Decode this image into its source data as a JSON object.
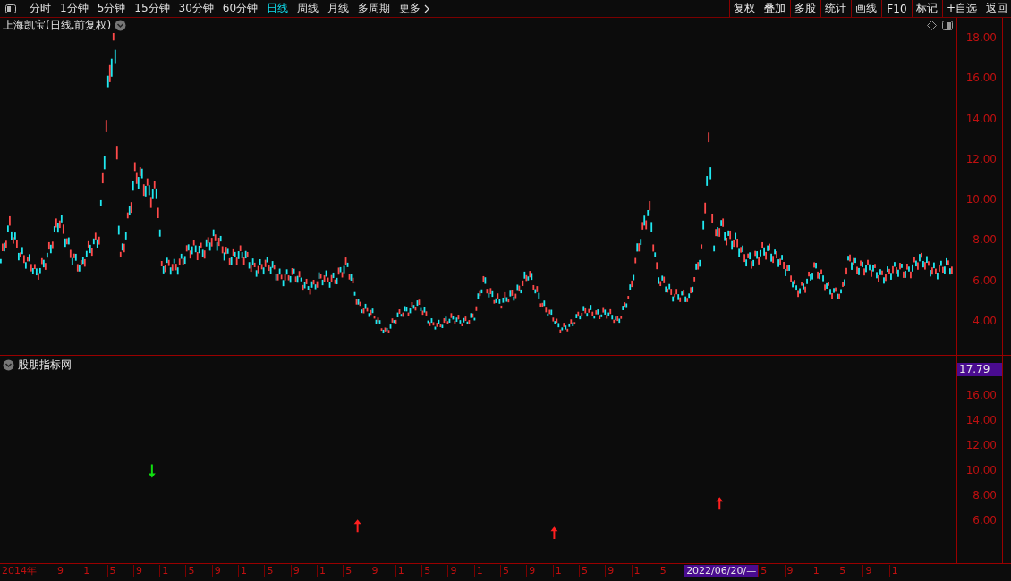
{
  "toolbar": {
    "periods": [
      {
        "label": "分时",
        "selected": false
      },
      {
        "label": "1分钟",
        "selected": false
      },
      {
        "label": "5分钟",
        "selected": false
      },
      {
        "label": "15分钟",
        "selected": false
      },
      {
        "label": "30分钟",
        "selected": false
      },
      {
        "label": "60分钟",
        "selected": false
      },
      {
        "label": "日线",
        "selected": true
      },
      {
        "label": "周线",
        "selected": false
      },
      {
        "label": "月线",
        "selected": false
      },
      {
        "label": "多周期",
        "selected": false
      }
    ],
    "more": "更多",
    "buttons": [
      "复权",
      "叠加",
      "多股",
      "统计",
      "画线",
      "F10",
      "标记",
      "+自选",
      "返回"
    ]
  },
  "main_chart": {
    "title": "上海凯宝(日线.前复权)",
    "y_labels": [
      "18.00",
      "16.00",
      "14.00",
      "12.00",
      "10.00",
      "8.00",
      "6.00",
      "4.00"
    ]
  },
  "indicator": {
    "title": "股朋指标网",
    "current_value": "17.79",
    "y_labels": [
      "16.00",
      "14.00",
      "12.00",
      "10.00",
      "8.00",
      "6.00"
    ],
    "signals": [
      {
        "kind": "down",
        "color": "#10e010"
      },
      {
        "kind": "up",
        "color": "#ff2020"
      },
      {
        "kind": "up",
        "color": "#ff2020"
      },
      {
        "kind": "up",
        "color": "#ff2020"
      }
    ]
  },
  "time_axis": {
    "labels": [
      {
        "text": "2014年",
        "highlighted": false
      },
      {
        "text": "9",
        "highlighted": false
      },
      {
        "text": "1",
        "highlighted": false
      },
      {
        "text": "5",
        "highlighted": false
      },
      {
        "text": "9",
        "highlighted": false
      },
      {
        "text": "1",
        "highlighted": false
      },
      {
        "text": "5",
        "highlighted": false
      },
      {
        "text": "9",
        "highlighted": false
      },
      {
        "text": "1",
        "highlighted": false
      },
      {
        "text": "5",
        "highlighted": false
      },
      {
        "text": "9",
        "highlighted": false
      },
      {
        "text": "1",
        "highlighted": false
      },
      {
        "text": "5",
        "highlighted": false
      },
      {
        "text": "9",
        "highlighted": false
      },
      {
        "text": "1",
        "highlighted": false
      },
      {
        "text": "5",
        "highlighted": false
      },
      {
        "text": "9",
        "highlighted": false
      },
      {
        "text": "1",
        "highlighted": false
      },
      {
        "text": "5",
        "highlighted": false
      },
      {
        "text": "9",
        "highlighted": false
      },
      {
        "text": "1",
        "highlighted": false
      },
      {
        "text": "5",
        "highlighted": false
      },
      {
        "text": "9",
        "highlighted": false
      },
      {
        "text": "1",
        "highlighted": false
      },
      {
        "text": "5",
        "highlighted": false
      },
      {
        "text": "2022/06/20/—",
        "highlighted": true
      },
      {
        "text": "5",
        "highlighted": false
      },
      {
        "text": "9",
        "highlighted": false
      },
      {
        "text": "1",
        "highlighted": false
      },
      {
        "text": "5",
        "highlighted": false
      },
      {
        "text": "9",
        "highlighted": false
      },
      {
        "text": "1",
        "highlighted": false
      }
    ]
  }
}
